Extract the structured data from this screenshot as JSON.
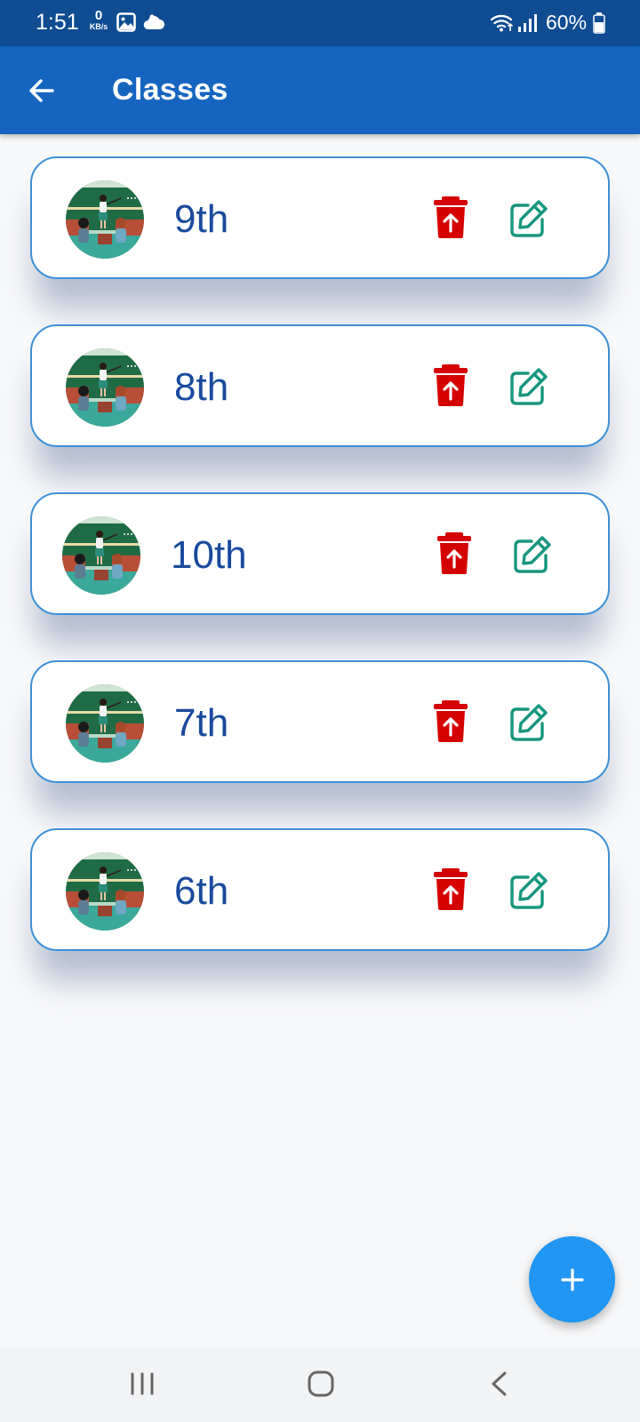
{
  "status_bar": {
    "time": "1:51",
    "data_rate": "0",
    "data_rate_unit": "KB/s",
    "battery": "60%",
    "icons": [
      "gallery-icon",
      "cloud-icon",
      "wifi-icon",
      "signal-icon",
      "battery-icon"
    ]
  },
  "app_bar": {
    "title": "Classes",
    "back_icon": "arrow-left-icon",
    "color": "#1565c0"
  },
  "classes": [
    {
      "label": "9th"
    },
    {
      "label": "8th"
    },
    {
      "label": "10th"
    },
    {
      "label": "7th"
    },
    {
      "label": "6th"
    }
  ],
  "row_actions": {
    "delete_icon": "delete-icon",
    "edit_icon": "edit-icon",
    "delete_color": "#d50000",
    "edit_color": "#17967f"
  },
  "fab": {
    "icon": "plus-icon",
    "color": "#2196f3"
  },
  "nav_bar": {
    "icons": [
      "recents-icon",
      "home-icon",
      "back-icon"
    ]
  },
  "colors": {
    "status_bar": "#0f4c92",
    "card_border": "#3d8fd6",
    "card_label": "#1a4a9c"
  }
}
